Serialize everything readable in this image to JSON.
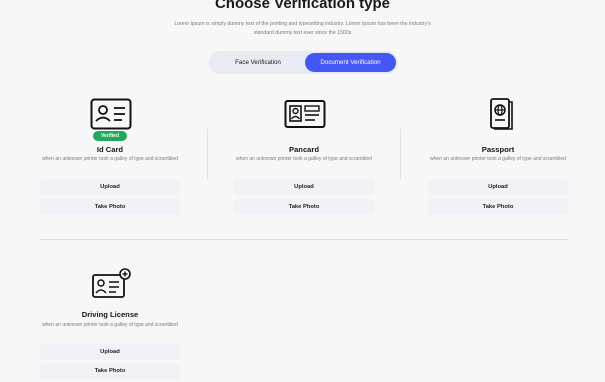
{
  "header": {
    "title": "Choose Verification type",
    "subtitle": "Lorem Ipsum is simply dummy text of the printing and typesetting industry. Lorem Ipsum has been the industry's standard dummy text ever since the 1500s"
  },
  "toggle": {
    "face_label": "Face Verification",
    "document_label": "Document Verification",
    "selected": "Document Verification"
  },
  "cards": [
    {
      "name": "Id Card",
      "badge": "Verified",
      "description": "when an unknown printer took a galley of type and scrambled",
      "upload_label": "Upload",
      "photo_label": "Take Photo",
      "icon": "id-card-icon"
    },
    {
      "name": "Pancard",
      "description": "when an unknown printer took a galley of type and scrambled",
      "upload_label": "Upload",
      "photo_label": "Take Photo",
      "icon": "pancard-icon"
    },
    {
      "name": "Passport",
      "description": "when an unknown printer took a galley of type and scrambled",
      "upload_label": "Upload",
      "photo_label": "Take Photo",
      "icon": "passport-icon"
    },
    {
      "name": "Driving License",
      "description": "when an unknown printer took a galley of type and scrambled",
      "upload_label": "Upload",
      "photo_label": "Take Photo",
      "icon": "driving-license-icon"
    }
  ],
  "colors": {
    "accent": "#4457f5",
    "verified": "#22a85a",
    "button_bg": "#f0f2f8"
  }
}
